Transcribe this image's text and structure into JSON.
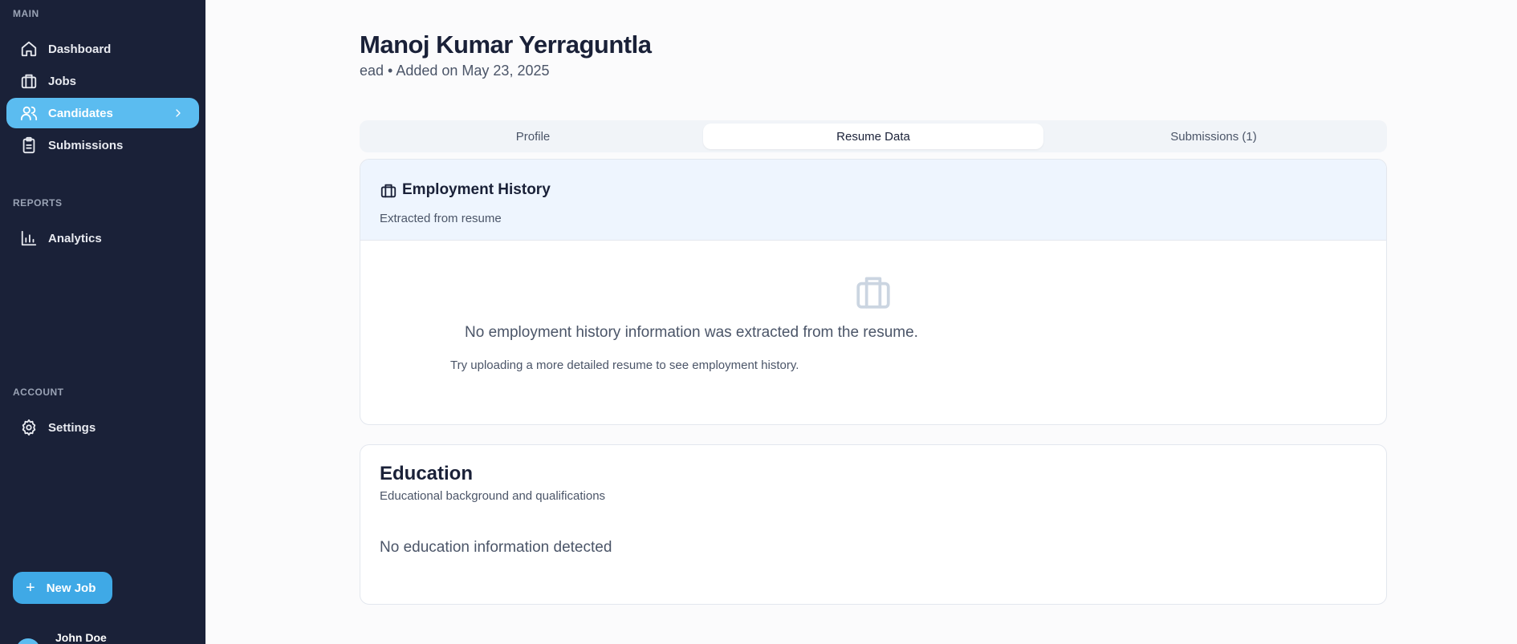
{
  "sidebar": {
    "sections": {
      "main": "MAIN",
      "reports": "REPORTS",
      "account": "ACCOUNT"
    },
    "items": {
      "dashboard": "Dashboard",
      "jobs": "Jobs",
      "candidates": "Candidates",
      "submissions": "Submissions",
      "analytics": "Analytics",
      "settings": "Settings"
    },
    "new_job_label": "New Job",
    "user_name": "John Doe"
  },
  "candidate": {
    "name": "Manoj Kumar Yerraguntla",
    "subtitle": "ead • Added on May 23, 2025"
  },
  "tabs": {
    "profile": "Profile",
    "resume_data": "Resume Data",
    "submissions": "Submissions (1)",
    "active": "resume_data"
  },
  "employment": {
    "title": "Employment History",
    "subtitle": "Extracted from resume",
    "empty_message": "No employment history information was extracted from the resume.",
    "empty_hint": "Try uploading a more detailed resume to see employment history."
  },
  "education": {
    "title": "Education",
    "subtitle": "Educational background and qualifications",
    "empty_message": "No education information detected"
  },
  "colors": {
    "sidebar_bg": "#1a2138",
    "accent": "#5bbcf0",
    "button": "#3fa9e6",
    "header_tint": "#eef5fe"
  },
  "icons": {
    "dashboard": "home-icon",
    "jobs": "briefcase-icon",
    "candidates": "users-icon",
    "submissions": "clipboard-icon",
    "analytics": "bar-chart-icon",
    "settings": "gear-icon"
  }
}
